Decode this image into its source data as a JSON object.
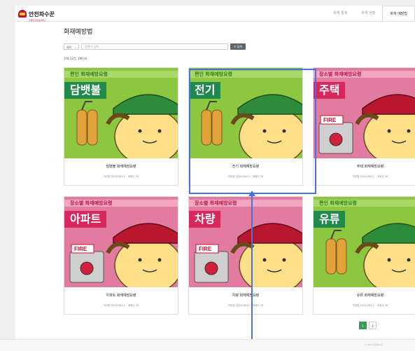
{
  "header": {
    "logo_text": "안전파수꾼",
    "logo_sub": "소방안전정보서비스",
    "nav": [
      "화재 통계",
      "화재 현황",
      "화재 예방법"
    ],
    "nav_active_index": 2
  },
  "main": {
    "title": "화재예방법",
    "search": {
      "select_value": "제목",
      "input_placeholder": "검색어 입력",
      "button_label": "검색"
    },
    "count_text": "전체 12건, 1페이지",
    "cards": [
      {
        "theme": "green",
        "band": "편인 화재예방요령",
        "heading": "담뱃불",
        "title": "담뱃불 화재예방요령",
        "date": "작성일 2024/08/13",
        "views": "조회수 20"
      },
      {
        "theme": "green",
        "band": "편인 화재예방요령",
        "heading": "전기",
        "title": "전기 화재예방요령",
        "date": "작성일 2024/08/13",
        "views": "조회수 16"
      },
      {
        "theme": "pink",
        "band": "장소별 화재예방요령",
        "heading": "주택",
        "title": "주택 화재예방요령",
        "date": "작성일 2024/08/13",
        "views": "조회수 16"
      },
      {
        "theme": "pink",
        "band": "장소별 화재예방요령",
        "heading": "아파트",
        "title": "아파트 화재예방요령",
        "date": "작성일 2024/08/13",
        "views": "조회수 20"
      },
      {
        "theme": "pink",
        "band": "장소별 화재예방요령",
        "heading": "차량",
        "title": "차량 화재예방요령",
        "date": "작성일 2024/08/13",
        "views": "조회수 16"
      },
      {
        "theme": "green",
        "band": "편인 화재예방요령",
        "heading": "유류",
        "title": "유류 화재예방요령",
        "date": "작성일 2024/08/13",
        "views": "조회수 16"
      }
    ],
    "fire_label": "FIRE",
    "pagination": [
      "1",
      "2"
    ],
    "pagination_active_index": 0
  },
  "footer": {
    "text": "© 2024 안전파수꾼"
  },
  "colors": {
    "highlight": "#4a72d8",
    "green": "#1f8a4c",
    "pink": "#d6285d"
  }
}
